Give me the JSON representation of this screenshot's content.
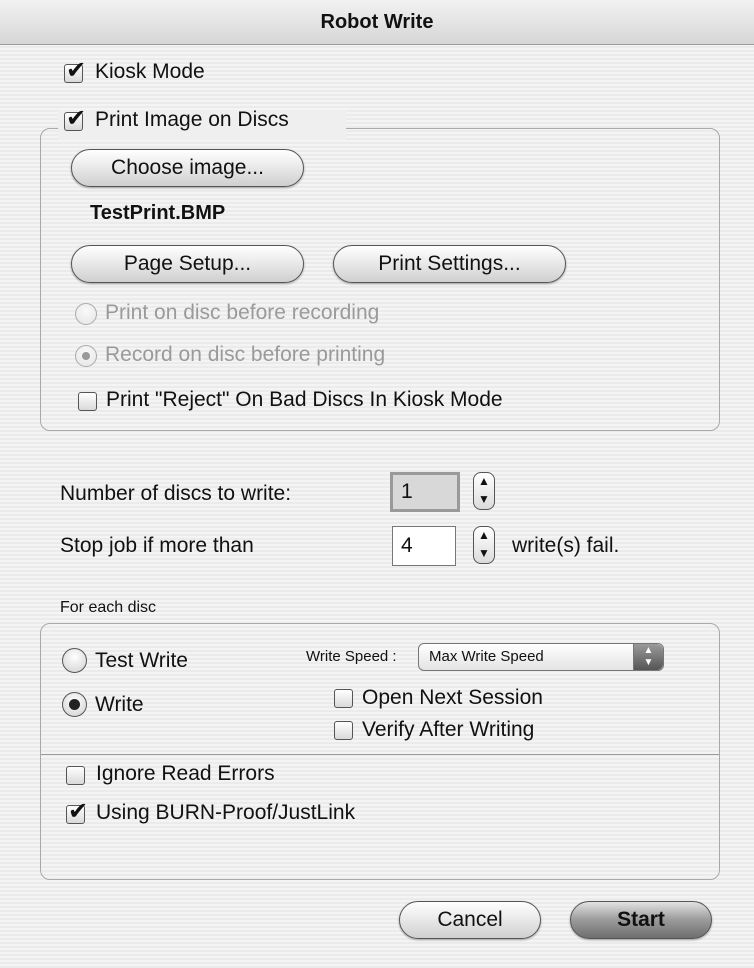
{
  "window": {
    "title": "Robot Write"
  },
  "kiosk_mode": {
    "label": "Kiosk Mode",
    "checked": true
  },
  "print_group": {
    "checkbox_label": "Print Image on Discs",
    "checked": true,
    "choose_image_label": "Choose image...",
    "selected_file": "TestPrint.BMP",
    "page_setup_label": "Page Setup...",
    "print_settings_label": "Print Settings...",
    "order_options": [
      {
        "label": "Print on disc before recording",
        "selected": false,
        "enabled": false
      },
      {
        "label": "Record on disc before printing",
        "selected": true,
        "enabled": false
      }
    ],
    "reject_label": "Print \"Reject\" On Bad Discs In Kiosk Mode",
    "reject_checked": false
  },
  "discs": {
    "label": "Number of discs to write:",
    "value": "1"
  },
  "stop_job": {
    "label": "Stop job if more than",
    "value": "4",
    "suffix": "write(s) fail."
  },
  "for_each_disc": {
    "heading": "For each disc",
    "test_write_label": "Test Write",
    "write_label": "Write",
    "selected_mode": "Write",
    "write_speed_label": "Write Speed :",
    "write_speed_value": "Max Write Speed",
    "open_next_session_label": "Open Next Session",
    "open_next_session_checked": false,
    "verify_label": "Verify After Writing",
    "verify_checked": false,
    "ignore_read_errors_label": "Ignore Read Errors",
    "ignore_read_errors_checked": false,
    "burn_proof_label": "Using BURN-Proof/JustLink",
    "burn_proof_checked": true
  },
  "buttons": {
    "cancel": "Cancel",
    "start": "Start"
  },
  "icons": {
    "check": "checkmark-glyph",
    "stepper": "up-down-arrows",
    "popup": "popup-arrows"
  }
}
